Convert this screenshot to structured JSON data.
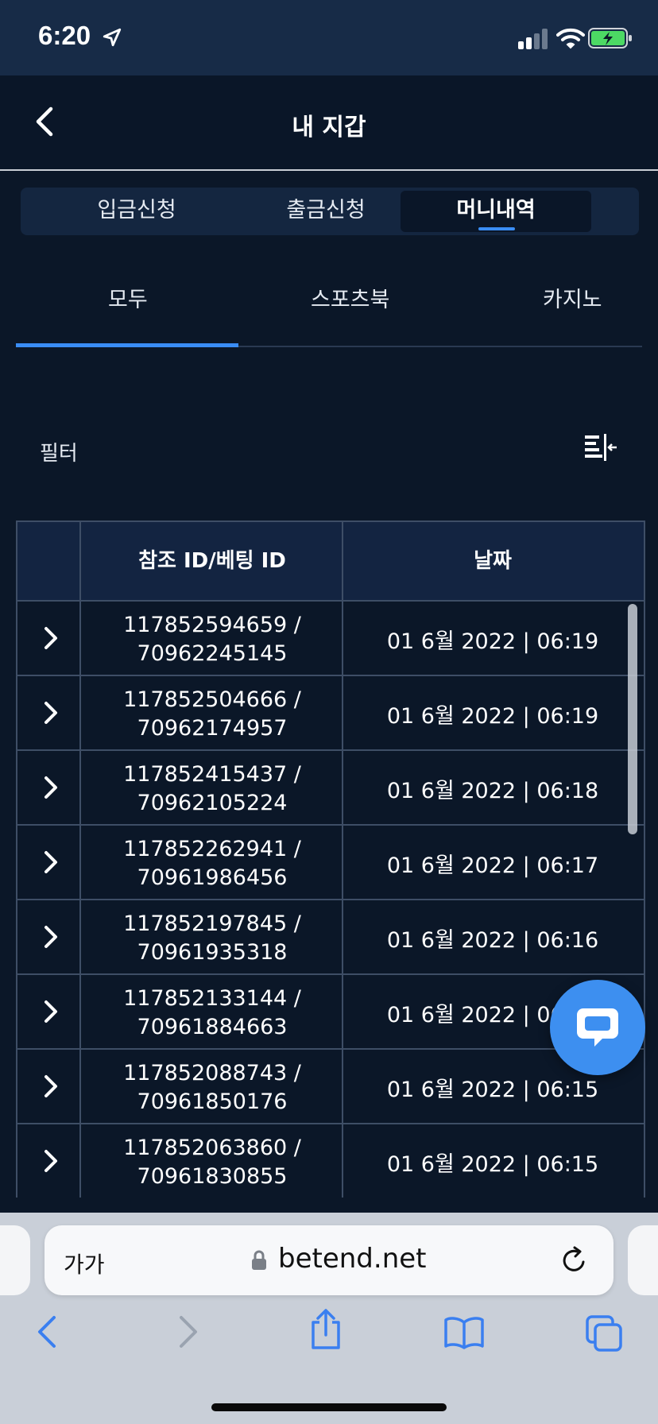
{
  "status_bar": {
    "time": "6:20"
  },
  "header": {
    "title": "내 지갑"
  },
  "segments": [
    {
      "label": "입금신청",
      "active": false
    },
    {
      "label": "출금신청",
      "active": false
    },
    {
      "label": "머니내역",
      "active": true
    }
  ],
  "subtabs": [
    {
      "label": "모두",
      "active": true
    },
    {
      "label": "스포츠북",
      "active": false
    },
    {
      "label": "카지노",
      "active": false
    }
  ],
  "filter": {
    "label": "필터"
  },
  "table": {
    "headers": [
      "참조 ID/베팅 ID",
      "날짜"
    ],
    "rows": [
      {
        "ref_id": "117852594659 /",
        "bet_id": "70962245145",
        "date": "01 6월 2022 | 06:19"
      },
      {
        "ref_id": "117852504666 /",
        "bet_id": "70962174957",
        "date": "01 6월 2022 | 06:19"
      },
      {
        "ref_id": "117852415437 /",
        "bet_id": "70962105224",
        "date": "01 6월 2022 | 06:18"
      },
      {
        "ref_id": "117852262941 /",
        "bet_id": "70961986456",
        "date": "01 6월 2022 | 06:17"
      },
      {
        "ref_id": "117852197845 /",
        "bet_id": "70961935318",
        "date": "01 6월 2022 | 06:16"
      },
      {
        "ref_id": "117852133144 /",
        "bet_id": "70961884663",
        "date": "01 6월 2022 | 06:16"
      },
      {
        "ref_id": "117852088743 /",
        "bet_id": "70961850176",
        "date": "01 6월 2022 | 06:15"
      },
      {
        "ref_id": "117852063860 /",
        "bet_id": "70961830855",
        "date": "01 6월 2022 | 06:15"
      }
    ]
  },
  "browser": {
    "text_size_label": "가가",
    "url": "betend.net"
  },
  "colors": {
    "accent": "#3a8df5",
    "background": "#0b1728",
    "header_bg": "#132441",
    "fab": "#3d8ff0"
  }
}
